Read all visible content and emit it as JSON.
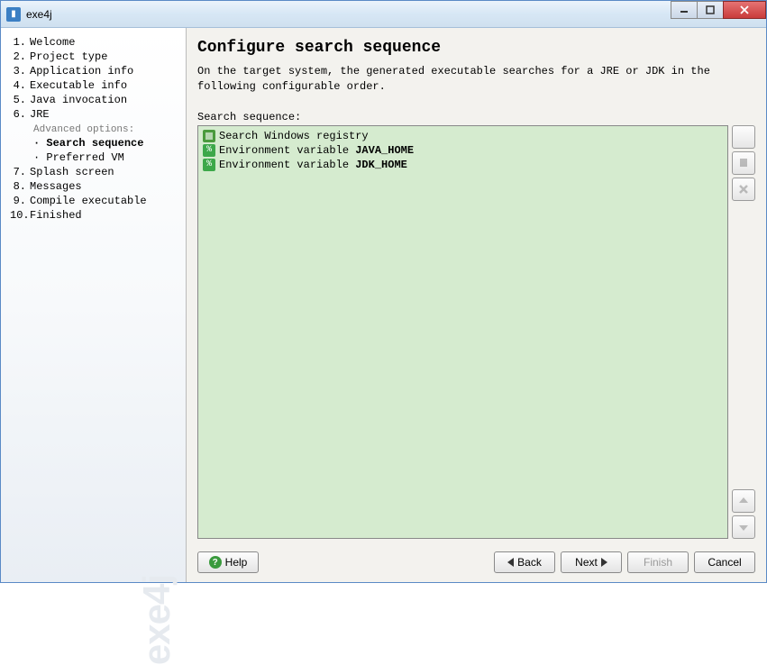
{
  "window": {
    "title": "exe4j"
  },
  "sidebar": {
    "items": [
      {
        "num": "1.",
        "label": "Welcome"
      },
      {
        "num": "2.",
        "label": "Project type"
      },
      {
        "num": "3.",
        "label": "Application info"
      },
      {
        "num": "4.",
        "label": "Executable info"
      },
      {
        "num": "5.",
        "label": "Java invocation"
      },
      {
        "num": "6.",
        "label": "JRE"
      },
      {
        "num": "7.",
        "label": "Splash screen"
      },
      {
        "num": "8.",
        "label": "Messages"
      },
      {
        "num": "9.",
        "label": "Compile executable"
      },
      {
        "num": "10.",
        "label": "Finished"
      }
    ],
    "advanced_label": "Advanced options:",
    "sub_items": [
      {
        "bullet": "·",
        "label": "Search sequence",
        "current": true
      },
      {
        "bullet": "·",
        "label": "Preferred VM",
        "current": false
      }
    ],
    "watermark": "exe4j"
  },
  "main": {
    "title": "Configure search sequence",
    "description": "On the target system, the generated executable searches for a JRE or JDK in the following configurable order.",
    "list_label": "Search sequence:",
    "list": [
      {
        "icon": "registry",
        "prefix": "Search Windows registry",
        "bold": ""
      },
      {
        "icon": "env",
        "prefix": "Environment variable ",
        "bold": "JAVA_HOME"
      },
      {
        "icon": "env",
        "prefix": "Environment variable ",
        "bold": "JDK_HOME"
      }
    ]
  },
  "footer": {
    "help": "Help",
    "back": "Back",
    "next": "Next",
    "finish": "Finish",
    "cancel": "Cancel"
  }
}
